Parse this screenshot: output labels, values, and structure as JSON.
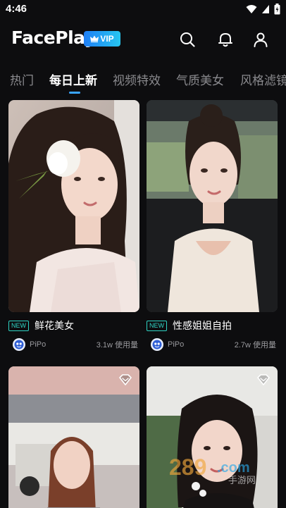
{
  "status_bar": {
    "time": "4:46",
    "icons": [
      "wifi-icon",
      "signal-icon",
      "battery-icon"
    ]
  },
  "header": {
    "logo": "FacePlay",
    "vip_label": "VIP",
    "icons": [
      "search-icon",
      "bell-icon",
      "profile-icon"
    ]
  },
  "tabs": [
    {
      "label": "热门",
      "active": false
    },
    {
      "label": "每日上新",
      "active": true
    },
    {
      "label": "视频特效",
      "active": false
    },
    {
      "label": "气质美女",
      "active": false
    },
    {
      "label": "风格滤镜",
      "active": false
    }
  ],
  "cards": [
    {
      "badge": "NEW",
      "title": "鲜花美女",
      "author": "PiPo",
      "usage": "3.1w 使用量"
    },
    {
      "badge": "NEW",
      "title": "性感姐姐自拍",
      "author": "PiPo",
      "usage": "2.7w 使用量"
    },
    {
      "title": "",
      "author": "",
      "usage": ""
    },
    {
      "title": "",
      "author": "",
      "usage": ""
    }
  ],
  "watermark": {
    "brand": "289",
    "suffix": ".com",
    "sub": "手游网"
  },
  "colors": {
    "background": "#0d0d0f",
    "accent": "#3aa5ff",
    "new_badge": "#2fd3c4",
    "vip_gradient_start": "#1f7ff5",
    "vip_gradient_end": "#27c6f0"
  }
}
